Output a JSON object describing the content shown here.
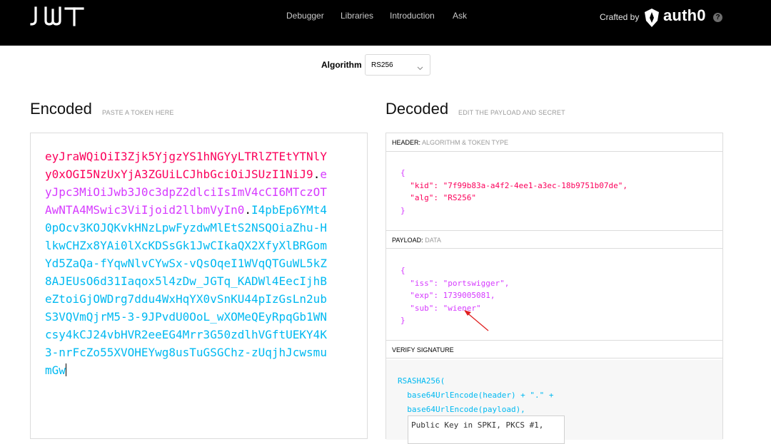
{
  "header": {
    "nav": [
      "Debugger",
      "Libraries",
      "Introduction",
      "Ask"
    ],
    "crafted_by": "Crafted by",
    "brand": "auth0",
    "help_icon": "?"
  },
  "algorithm": {
    "label": "Algorithm",
    "value": "RS256"
  },
  "encoded": {
    "title": "Encoded",
    "hint": "PASTE A TOKEN HERE",
    "token_header": "eyJraWQiOiI3Zjk5YjgzYS1hNGYyLTRlZTEtYTNlYy0xOGI5NzUxYjA3ZGUiLCJhbGciOiJSUzI1NiJ9",
    "token_payload": "eyJpc3MiOiJwb3J0c3dpZ2dlciIsImV4cCI6MTczOTAwNTA4MSwic3ViIjoid2llbmVyIn0",
    "token_signature": "I4pbEp6YMt40pOcv3KOJQKvkHNzLpwFyzdwMlEtS2NSQOiaZhu-HlkwCHZx8YAi0lXcKDSsGk1JwCIkaQX2XfyXlBRGomYd5ZaQa-fYqwNlvCYwSx-vQsOqeI1WVqQTGuWL5kZ8AJEUsO6d31Iaqox5l4zDw_JGTq_KADWl4EecIjhBeZtoiGjOWDrg7ddu4WxHqYX0vSnKU44pIzGsLn2ubS3VQVmQjrM5-3-9JPvdU0OoL_wXOMeQEyRpqGb1WNcsy4kCJ24vbHVR2eeEG4Mrr3G50zdlhVGftUEKY4K3-nrFcZo55XVOHEYwg8usTuGSGChz-zUqjhJcwsmumGw"
  },
  "decoded": {
    "title": "Decoded",
    "hint": "EDIT THE PAYLOAD AND SECRET",
    "header_section": {
      "label": "HEADER:",
      "sublabel": "ALGORITHM & TOKEN TYPE"
    },
    "header_json": "{\n  \"kid\": \"7f99b83a-a4f2-4ee1-a3ec-18b9751b07de\",\n  \"alg\": \"RS256\"\n}",
    "payload_section": {
      "label": "PAYLOAD:",
      "sublabel": "DATA"
    },
    "payload_json": "{\n  \"iss\": \"portswigger\",\n  \"exp\": 1739005081,\n  \"sub\": \"wiener\"\n}",
    "verify_section": {
      "label": "VERIFY SIGNATURE"
    },
    "verify_code": "RSASHA256(\n  base64UrlEncode(header) + \".\" +\n  base64UrlEncode(payload),",
    "public_key_placeholder": "Public Key in SPKI, PKCS #1,"
  }
}
